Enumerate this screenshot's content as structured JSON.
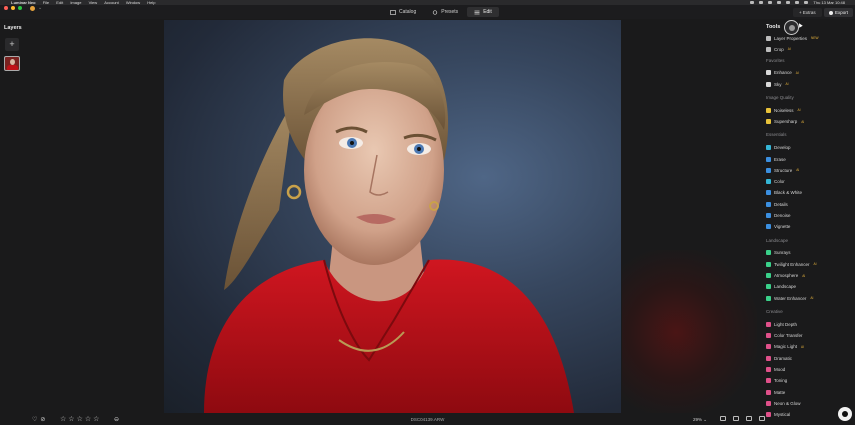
{
  "menubar": {
    "app_name": "Luminar Neo",
    "items": [
      "File",
      "Edit",
      "Image",
      "View",
      "Account",
      "Window",
      "Help"
    ],
    "clock": "Thu 13 Mar 10:48"
  },
  "toolbar": {
    "tabs": [
      {
        "label": "Catalog",
        "icon": "catalog-icon"
      },
      {
        "label": "Presets",
        "icon": "presets-icon"
      },
      {
        "label": "Edit",
        "icon": "edit-sliders-icon",
        "active": true
      }
    ],
    "extras_label": "Extras",
    "export_label": "Export"
  },
  "layers": {
    "title": "Layers",
    "add_label": "+"
  },
  "canvas": {
    "filename": "DSC04139.ARW",
    "zoom": "29%"
  },
  "bottombar": {
    "rating_stars": 5,
    "star_glyph": "☆",
    "heart_glyph": "♡",
    "reject_glyph": "⊘"
  },
  "sidebar": {
    "tools_title": "Tools",
    "top_items": [
      {
        "label": "Layer Properties",
        "badge": "NEW",
        "icon_color": "#bdbdbd"
      },
      {
        "label": "Crop",
        "badge": "AI",
        "icon_color": "#bdbdbd"
      }
    ],
    "sections": [
      {
        "title": "Favorites",
        "items": [
          {
            "label": "Enhance",
            "badge": "AI",
            "icon_color": "#d9d9d9"
          },
          {
            "label": "Sky",
            "badge": "AI",
            "icon_color": "#d9d9d9"
          }
        ]
      },
      {
        "title": "Image Quality",
        "items": [
          {
            "label": "Noiseless",
            "badge": "AI",
            "icon_color": "#e8c23a"
          },
          {
            "label": "Supersharp",
            "badge": "AI",
            "icon_color": "#e8c23a"
          }
        ]
      },
      {
        "title": "Essentials",
        "items": [
          {
            "label": "Develop",
            "badge": "",
            "icon_color": "#35b6d6"
          },
          {
            "label": "Erase",
            "badge": "",
            "icon_color": "#3b8fe0"
          },
          {
            "label": "Structure",
            "badge": "AI",
            "icon_color": "#3b8fe0"
          },
          {
            "label": "Color",
            "badge": "",
            "icon_color": "#35b6d6"
          },
          {
            "label": "Black & White",
            "badge": "",
            "icon_color": "#3b8fe0"
          },
          {
            "label": "Details",
            "badge": "",
            "icon_color": "#3b8fe0"
          },
          {
            "label": "Denoise",
            "badge": "",
            "icon_color": "#3b8fe0"
          },
          {
            "label": "Vignette",
            "badge": "",
            "icon_color": "#3b8fe0"
          }
        ]
      },
      {
        "title": "Landscape",
        "items": [
          {
            "label": "Sunrays",
            "badge": "",
            "icon_color": "#3ad18a"
          },
          {
            "label": "Twilight Enhancer",
            "badge": "AI",
            "icon_color": "#3ad18a"
          },
          {
            "label": "Atmosphere",
            "badge": "AI",
            "icon_color": "#3ad18a"
          },
          {
            "label": "Landscape",
            "badge": "",
            "icon_color": "#3ad18a"
          },
          {
            "label": "Water Enhancer",
            "badge": "AI",
            "icon_color": "#3ad18a"
          }
        ]
      },
      {
        "title": "Creative",
        "items": [
          {
            "label": "Light Depth",
            "badge": "",
            "icon_color": "#e0508a"
          },
          {
            "label": "Color Transfer",
            "badge": "",
            "icon_color": "#e0508a"
          },
          {
            "label": "Magic Light",
            "badge": "AI",
            "icon_color": "#e0508a"
          },
          {
            "label": "Dramatic",
            "badge": "",
            "icon_color": "#e0508a"
          },
          {
            "label": "Mood",
            "badge": "",
            "icon_color": "#e0508a"
          },
          {
            "label": "Toning",
            "badge": "",
            "icon_color": "#e0508a"
          },
          {
            "label": "Matte",
            "badge": "",
            "icon_color": "#e0508a"
          },
          {
            "label": "Neon & Glow",
            "badge": "",
            "icon_color": "#e0508a"
          },
          {
            "label": "Mystical",
            "badge": "",
            "icon_color": "#e0508a"
          }
        ]
      }
    ]
  }
}
